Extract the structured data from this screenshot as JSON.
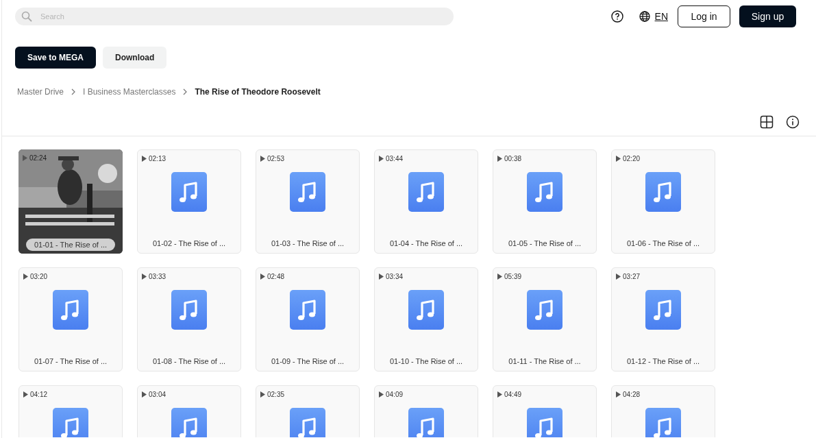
{
  "search": {
    "placeholder": "Search"
  },
  "header": {
    "language": "EN",
    "buttons": [
      {
        "label": "Log in",
        "kind": "outline"
      },
      {
        "label": "Sign up",
        "kind": "primary"
      }
    ]
  },
  "actions": [
    {
      "label": "Save to MEGA",
      "kind": "primary"
    },
    {
      "label": "Download",
      "kind": "secondary"
    }
  ],
  "breadcrumb": [
    {
      "label": "Master Drive",
      "current": false
    },
    {
      "label": "I Business Masterclasses",
      "current": false
    },
    {
      "label": "The Rise of Theodore Roosevelt",
      "current": true
    }
  ],
  "files": [
    {
      "duration": "02:24",
      "title": "01-01 - The Rise of ...",
      "kind": "picture"
    },
    {
      "duration": "02:13",
      "title": "01-02 - The Rise of ...",
      "kind": "audio"
    },
    {
      "duration": "02:53",
      "title": "01-03 - The Rise of ...",
      "kind": "audio"
    },
    {
      "duration": "03:44",
      "title": "01-04 - The Rise of ...",
      "kind": "audio"
    },
    {
      "duration": "00:38",
      "title": "01-05 - The Rise of ...",
      "kind": "audio"
    },
    {
      "duration": "02:20",
      "title": "01-06 - The Rise of ...",
      "kind": "audio"
    },
    {
      "duration": "03:20",
      "title": "01-07 - The Rise of ...",
      "kind": "audio"
    },
    {
      "duration": "03:33",
      "title": "01-08 - The Rise of ...",
      "kind": "audio"
    },
    {
      "duration": "02:48",
      "title": "01-09 - The Rise of ...",
      "kind": "audio"
    },
    {
      "duration": "03:34",
      "title": "01-10 - The Rise of ...",
      "kind": "audio"
    },
    {
      "duration": "05:39",
      "title": "01-11 - The Rise of ...",
      "kind": "audio"
    },
    {
      "duration": "03:27",
      "title": "01-12 - The Rise of ...",
      "kind": "audio"
    },
    {
      "duration": "04:12",
      "kind": "audio"
    },
    {
      "duration": "03:04",
      "kind": "audio"
    },
    {
      "duration": "02:35",
      "kind": "audio"
    },
    {
      "duration": "04:09",
      "kind": "audio"
    },
    {
      "duration": "04:49",
      "kind": "audio"
    },
    {
      "duration": "04:28",
      "kind": "audio"
    }
  ]
}
